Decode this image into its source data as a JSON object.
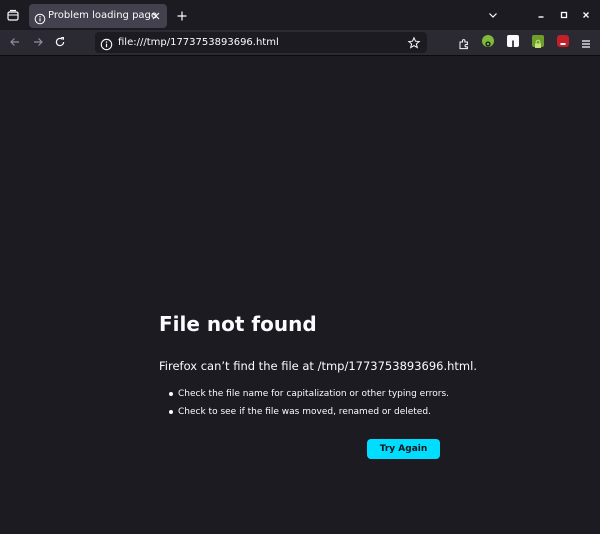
{
  "tab": {
    "title": "Problem loading page"
  },
  "toolbar": {
    "url": "file:///tmp/1773753893696.html"
  },
  "extensions": [
    {
      "name": "extension-puzzle-icon",
      "color": "#fbfbfe"
    },
    {
      "name": "extension-green-icon",
      "color": "#7fba3b"
    },
    {
      "name": "extension-white-icon",
      "color": "#fbfbfe"
    },
    {
      "name": "extension-lock-icon",
      "color": "#6e9e2a"
    },
    {
      "name": "extension-ublock-icon",
      "color": "#c4202a"
    }
  ],
  "error": {
    "title": "File not found",
    "description": "Firefox can’t find the file at /tmp/1773753893696.html.",
    "suggestions": [
      "Check the file name for capitalization or other typing errors.",
      "Check to see if the file was moved, renamed or deleted."
    ],
    "button_label": "Try Again"
  },
  "colors": {
    "page_bg": "#1c1b22",
    "toolbar_bg": "#2b2a33",
    "tab_bg": "#42414d",
    "accent": "#00ddff"
  }
}
